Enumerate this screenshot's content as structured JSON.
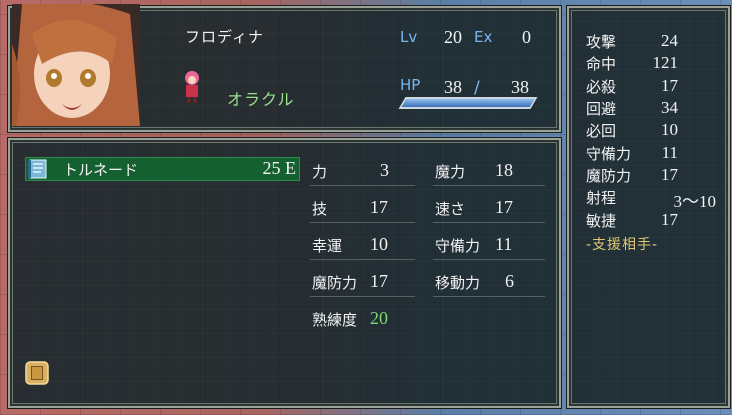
{
  "unit": {
    "name": "フロディナ",
    "class": "オラクル",
    "lv_label": "Lv",
    "lv": "20",
    "ex_label": "Ex",
    "ex": "0",
    "hp_label": "HP",
    "hp_current": "38",
    "hp_separator": "/",
    "hp_max": "38",
    "hp_fraction": 1.0
  },
  "item": {
    "name": "トルネード",
    "uses": "25",
    "rank": "E",
    "icon": "tome-icon"
  },
  "stats_left": [
    {
      "label": "力",
      "value": "3"
    },
    {
      "label": "技",
      "value": "17"
    },
    {
      "label": "幸運",
      "value": "10"
    },
    {
      "label": "魔防力",
      "value": "17"
    },
    {
      "label": "熟練度",
      "value": "20"
    }
  ],
  "stats_right": [
    {
      "label": "魔力",
      "value": "18"
    },
    {
      "label": "速さ",
      "value": "17"
    },
    {
      "label": "守備力",
      "value": "11"
    },
    {
      "label": "移動力",
      "value": "6"
    }
  ],
  "combat": [
    {
      "label": "攻撃",
      "value": "24"
    },
    {
      "label": "命中",
      "value": "121"
    },
    {
      "label": "必殺",
      "value": "17"
    },
    {
      "label": "回避",
      "value": "34"
    },
    {
      "label": "必回",
      "value": "10"
    },
    {
      "label": "守備力",
      "value": "11"
    },
    {
      "label": "魔防力",
      "value": "17"
    },
    {
      "label": "射程",
      "value": "3〜10"
    },
    {
      "label": "敏捷",
      "value": "17"
    }
  ],
  "support_label": "-支援相手-",
  "colors": {
    "panel": "#1c282c",
    "class_text": "#9be08c",
    "label_blue": "#78b6ee",
    "selected_row": "#156030",
    "support_text": "#e0c872"
  }
}
